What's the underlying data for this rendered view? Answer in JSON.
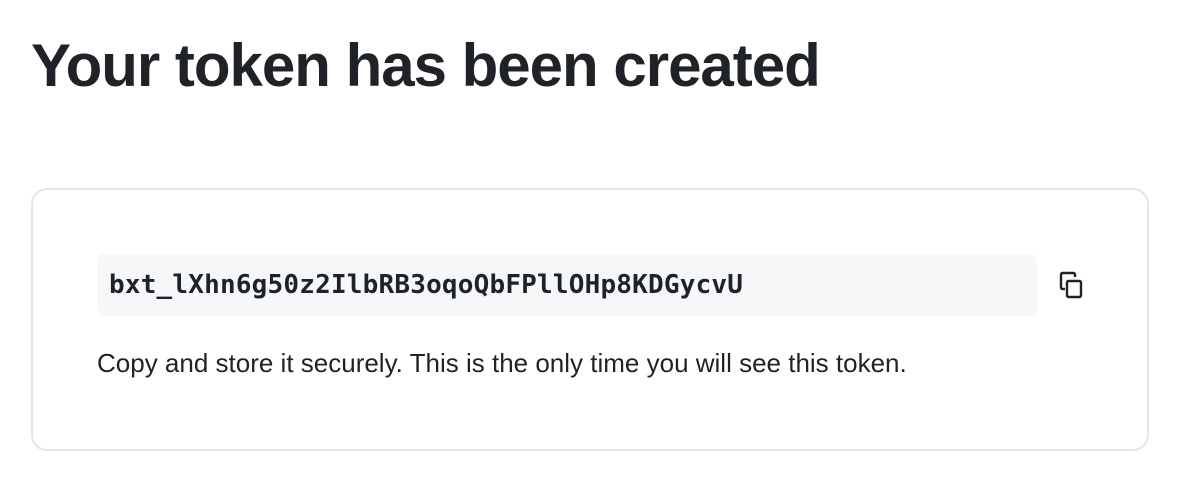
{
  "page": {
    "title": "Your token has been created"
  },
  "token_card": {
    "token_value": "bxt_lXhn6g50z2IlbRB3oqoQbFPllOHp8KDGycvU",
    "copy_icon": "copy-icon",
    "help_text": "Copy and store it securely. This is the only time you will see this token."
  },
  "colors": {
    "text": "#1f2328",
    "card_border": "#e4e5e8",
    "token_bg": "#f6f7f9"
  }
}
